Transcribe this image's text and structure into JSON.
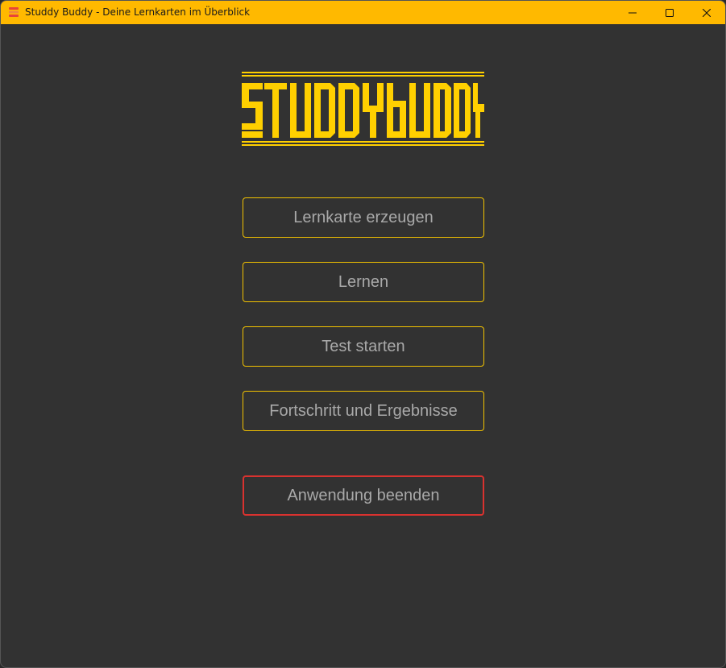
{
  "window": {
    "title": "Studdy Buddy - Deine Lernkarten im Überblick",
    "icon": "app-stack-icon",
    "controls": {
      "minimize": "minimize-icon",
      "maximize": "maximize-icon",
      "close": "close-icon"
    }
  },
  "logo": {
    "text": "STUDDYBUDDY",
    "color": "#ffd000"
  },
  "menu": {
    "create_card": "Lernkarte erzeugen",
    "learn": "Lernen",
    "start_test": "Test starten",
    "progress": "Fortschritt und Ergebnisse",
    "exit": "Anwendung beenden"
  },
  "colors": {
    "titlebar": "#ffb900",
    "background": "#323232",
    "button_border": "#f2c200",
    "exit_border": "#d9322f",
    "button_text": "#a9a9a9"
  }
}
